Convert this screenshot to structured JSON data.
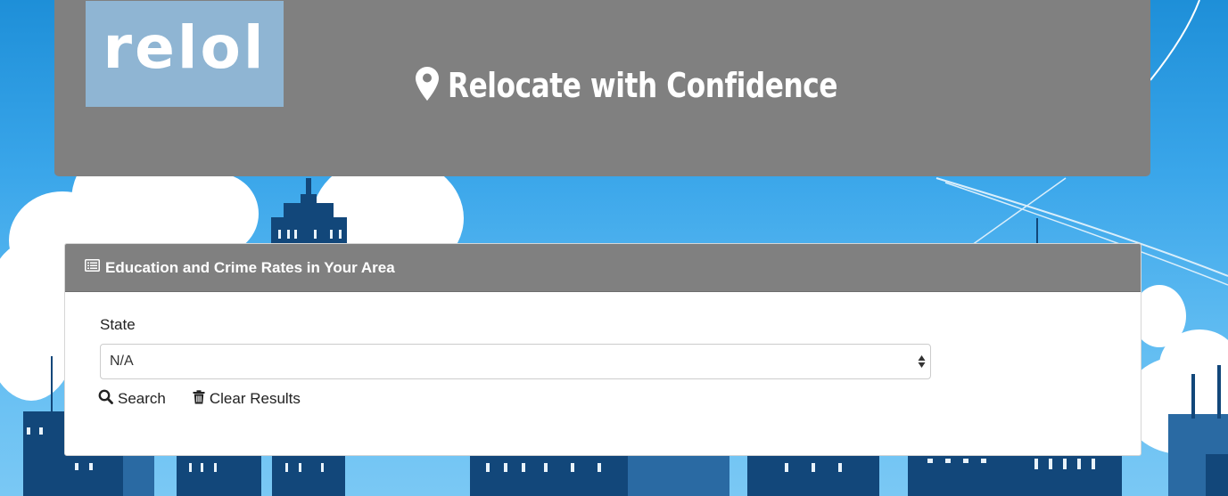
{
  "header": {
    "logo_text": "relol",
    "tagline": "Relocate with Confidence"
  },
  "panel": {
    "title": "Education and Crime Rates in Your Area",
    "state_label": "State",
    "state_select": {
      "selected": "N/A"
    },
    "search_label": "Search",
    "clear_label": "Clear Results"
  },
  "icons": {
    "logo_area": "logo",
    "tagline": "map-marker-icon",
    "panel_header": "list-alt-icon",
    "search": "search-icon",
    "clear": "trash-icon",
    "select": "select-arrows-icon"
  },
  "colors": {
    "header_bg": "#808080",
    "logo_bg": "#8fb5d3",
    "sky": "#3aa6ea",
    "buildings": "#12477a"
  }
}
